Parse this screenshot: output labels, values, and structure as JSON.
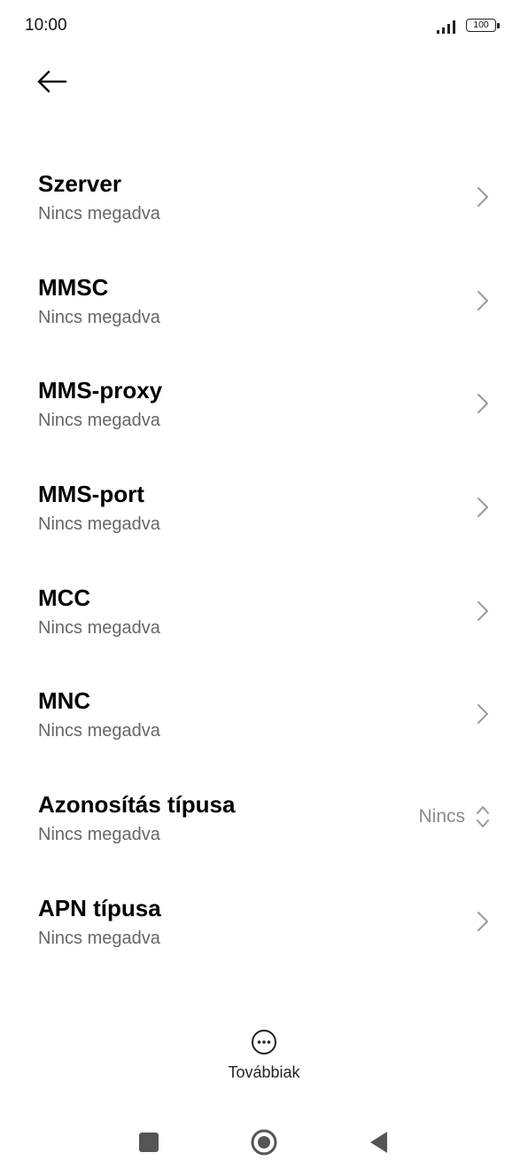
{
  "status_bar": {
    "time": "10:00",
    "battery": "100",
    "icons": [
      "signal-icon",
      "battery-icon"
    ]
  },
  "header": {
    "back_icon": "arrow-left-icon"
  },
  "settings": [
    {
      "title": "Szerver",
      "value": "Nincs megadva",
      "icon": "chevron-right-icon"
    },
    {
      "title": "MMSC",
      "value": "Nincs megadva",
      "icon": "chevron-right-icon"
    },
    {
      "title": "MMS-proxy",
      "value": "Nincs megadva",
      "icon": "chevron-right-icon"
    },
    {
      "title": "MMS-port",
      "value": "Nincs megadva",
      "icon": "chevron-right-icon"
    },
    {
      "title": "MCC",
      "value": "Nincs megadva",
      "icon": "chevron-right-icon"
    },
    {
      "title": "MNC",
      "value": "Nincs megadva",
      "icon": "chevron-right-icon"
    },
    {
      "title": "Azonosítás típusa",
      "value": "Nincs megadva",
      "selected": "Nincs",
      "icon": "updown-icon"
    },
    {
      "title": "APN típusa",
      "value": "Nincs megadva",
      "icon": "chevron-right-icon"
    }
  ],
  "footer": {
    "more_label": "Továbbiak",
    "more_icon": "more-horizontal-icon"
  },
  "nav": {
    "icons": [
      "recents-square-icon",
      "home-circle-icon",
      "back-triangle-icon"
    ]
  },
  "colors": {
    "title": "#000000",
    "subtitle": "#666666",
    "chevron": "#9a9a9a",
    "background": "#ffffff"
  }
}
